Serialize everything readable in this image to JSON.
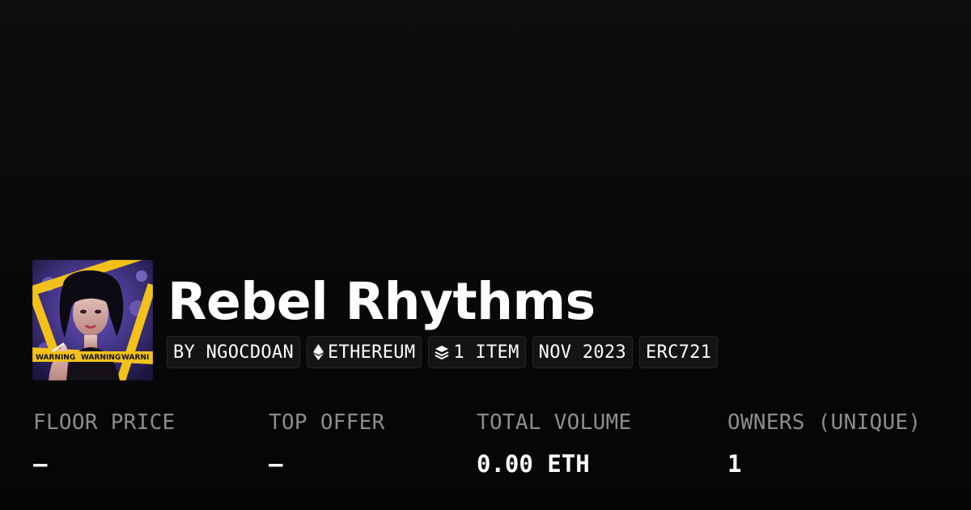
{
  "collection": {
    "title": "Rebel Rhythms",
    "avatar_icon": "collection-artwork",
    "avatar_banner_text": "WARNING"
  },
  "pills": [
    {
      "label": "BY NGOCDOAN",
      "icon": null
    },
    {
      "label": "ETHEREUM",
      "icon": "ethereum-icon"
    },
    {
      "label": "1 ITEM",
      "icon": "layers-icon"
    },
    {
      "label": "NOV 2023",
      "icon": null
    },
    {
      "label": "ERC721",
      "icon": null
    }
  ],
  "stats": [
    {
      "label": "FLOOR PRICE",
      "value": "–"
    },
    {
      "label": "TOP OFFER",
      "value": "–"
    },
    {
      "label": "TOTAL VOLUME",
      "value": "0.00 ETH"
    },
    {
      "label": "OWNERS (UNIQUE)",
      "value": "1"
    }
  ],
  "colors": {
    "background": "#0a0a0a",
    "pill_background": "#141414",
    "label_gray": "#8d8d8d",
    "text": "#ffffff",
    "avatar_purple": "#4b3a8a",
    "avatar_tape_yellow": "#f2c21b"
  }
}
